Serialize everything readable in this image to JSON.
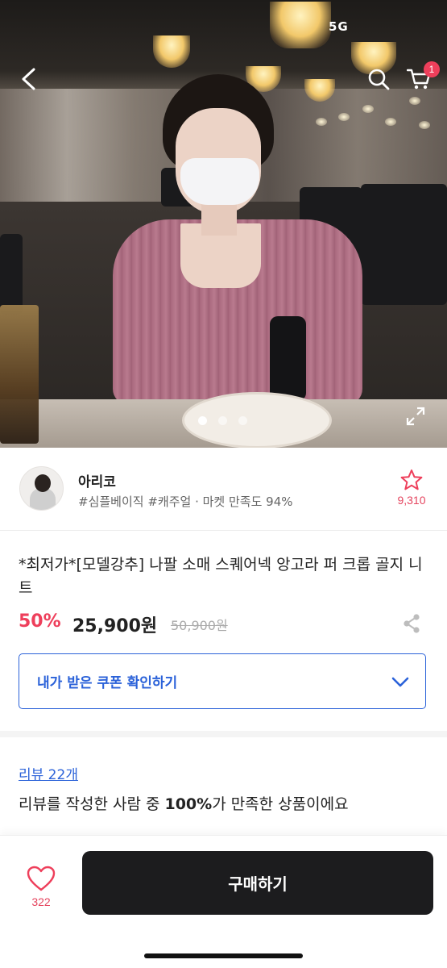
{
  "status_bar": {
    "signal": "5G"
  },
  "header": {
    "back_icon": "chevron-left-icon",
    "search_icon": "search-icon",
    "cart_icon": "cart-icon",
    "cart_badge": "1"
  },
  "gallery": {
    "image_count": 3,
    "active_index": 0,
    "expand_icon": "expand-icon"
  },
  "store": {
    "name": "아리코",
    "tags": "#심플베이직 #캐주얼 · 마켓 만족도 94%",
    "favorite_count": "9,310"
  },
  "product": {
    "title": "*최저가*[모델강추] 나팔 소매 스퀘어넥 앙고라 퍼 크롭 골지 니트",
    "discount": "50%",
    "price": "25,900원",
    "original_price": "50,900원"
  },
  "coupon": {
    "label": "내가 받은 쿠폰 확인하기"
  },
  "reviews": {
    "link": "리뷰 22개",
    "summary_prefix": "리뷰를 작성한 사람 중 ",
    "summary_percent": "100%",
    "summary_suffix": "가 만족한 상품이에요"
  },
  "bottom_bar": {
    "like_count": "322",
    "buy_label": "구매하기"
  },
  "colors": {
    "accent_red": "#ee3f5b",
    "link_blue": "#2b62d9",
    "buy_button": "#1c1c1e"
  }
}
